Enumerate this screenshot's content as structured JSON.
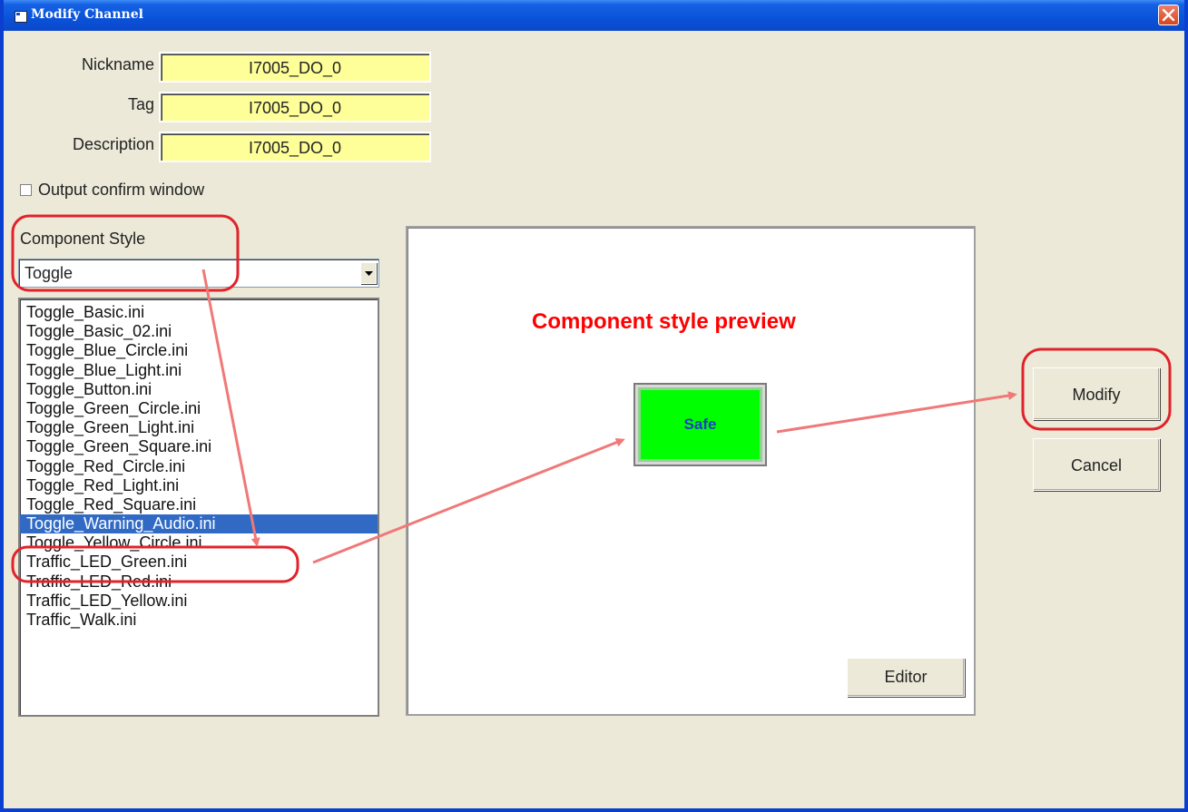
{
  "window": {
    "title": "Modify Channel"
  },
  "fields": {
    "nickname": {
      "label": "Nickname",
      "value": "I7005_DO_0"
    },
    "tag": {
      "label": "Tag",
      "value": "I7005_DO_0"
    },
    "description": {
      "label": "Description",
      "value": "I7005_DO_0"
    }
  },
  "output_confirm": {
    "label": "Output confirm window",
    "checked": false
  },
  "component_style": {
    "label": "Component Style",
    "selected": "Toggle",
    "items": [
      "Toggle_Basic.ini",
      "Toggle_Basic_02.ini",
      "Toggle_Blue_Circle.ini",
      "Toggle_Blue_Light.ini",
      "Toggle_Button.ini",
      "Toggle_Green_Circle.ini",
      "Toggle_Green_Light.ini",
      "Toggle_Green_Square.ini",
      "Toggle_Red_Circle.ini",
      "Toggle_Red_Light.ini",
      "Toggle_Red_Square.ini",
      "Toggle_Warning_Audio.ini",
      "Toggle_Yellow_Circle.ini",
      "Traffic_LED_Green.ini",
      "Traffic_LED_Red.ini",
      "Traffic_LED_Yellow.ini",
      "Traffic_Walk.ini"
    ],
    "selected_item": "Toggle_Warning_Audio.ini"
  },
  "preview": {
    "title": "Component style preview",
    "sample_label": "Safe",
    "editor_button": "Editor"
  },
  "buttons": {
    "modify": "Modify",
    "cancel": "Cancel"
  },
  "colors": {
    "titlebar": "#0a52da",
    "field_bg": "#ffff99",
    "selection": "#316ac5",
    "preview_title": "#ff0000",
    "sample_fill": "#00ff00",
    "annotation": "#e0232a"
  }
}
